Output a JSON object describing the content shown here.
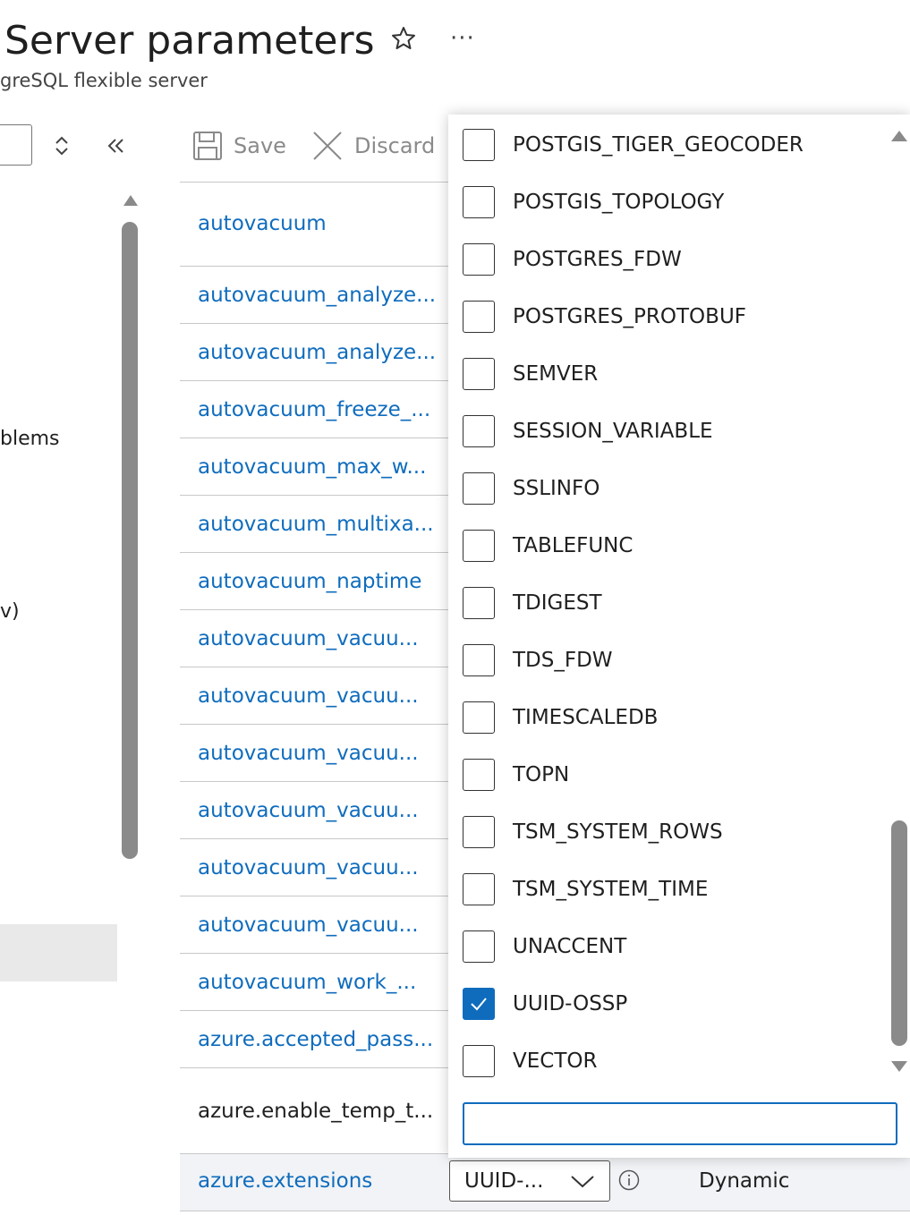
{
  "header": {
    "title": "Server parameters",
    "subtitle": "greSQL flexible server",
    "favorite_icon": "star-icon",
    "more_icon": "more-icon",
    "more_label": "···"
  },
  "left_nav": {
    "sort_icon": "sort-icon",
    "collapse_icon": "double-chevron-left-icon",
    "items": [
      {
        "label": "blems"
      },
      {
        "label": "v)"
      }
    ]
  },
  "toolbar": {
    "save_label": "Save",
    "discard_label": "Discard"
  },
  "parameters": [
    {
      "name": "autovacuum"
    },
    {
      "name": "autovacuum_analyze..."
    },
    {
      "name": "autovacuum_analyze..."
    },
    {
      "name": "autovacuum_freeze_..."
    },
    {
      "name": "autovacuum_max_w..."
    },
    {
      "name": "autovacuum_multixa..."
    },
    {
      "name": "autovacuum_naptime"
    },
    {
      "name": "autovacuum_vacuu..."
    },
    {
      "name": "autovacuum_vacuu..."
    },
    {
      "name": "autovacuum_vacuu..."
    },
    {
      "name": "autovacuum_vacuu..."
    },
    {
      "name": "autovacuum_vacuu..."
    },
    {
      "name": "autovacuum_vacuu..."
    },
    {
      "name": "autovacuum_work_..."
    },
    {
      "name": "azure.accepted_pass..."
    },
    {
      "name": "azure.enable_temp_t..."
    }
  ],
  "selected_row": {
    "name": "azure.extensions",
    "value": "UUID-...",
    "type": "Dynamic"
  },
  "dropdown": {
    "options": [
      {
        "label": "POSTGIS_TIGER_GEOCODER",
        "checked": false
      },
      {
        "label": "POSTGIS_TOPOLOGY",
        "checked": false
      },
      {
        "label": "POSTGRES_FDW",
        "checked": false
      },
      {
        "label": "POSTGRES_PROTOBUF",
        "checked": false
      },
      {
        "label": "SEMVER",
        "checked": false
      },
      {
        "label": "SESSION_VARIABLE",
        "checked": false
      },
      {
        "label": "SSLINFO",
        "checked": false
      },
      {
        "label": "TABLEFUNC",
        "checked": false
      },
      {
        "label": "TDIGEST",
        "checked": false
      },
      {
        "label": "TDS_FDW",
        "checked": false
      },
      {
        "label": "TIMESCALEDB",
        "checked": false
      },
      {
        "label": "TOPN",
        "checked": false
      },
      {
        "label": "TSM_SYSTEM_ROWS",
        "checked": false
      },
      {
        "label": "TSM_SYSTEM_TIME",
        "checked": false
      },
      {
        "label": "UNACCENT",
        "checked": false
      },
      {
        "label": "UUID-OSSP",
        "checked": true
      },
      {
        "label": "VECTOR",
        "checked": false
      }
    ],
    "filter_value": ""
  },
  "colors": {
    "link": "#0f6cbd",
    "accent": "#0f6cbd"
  }
}
